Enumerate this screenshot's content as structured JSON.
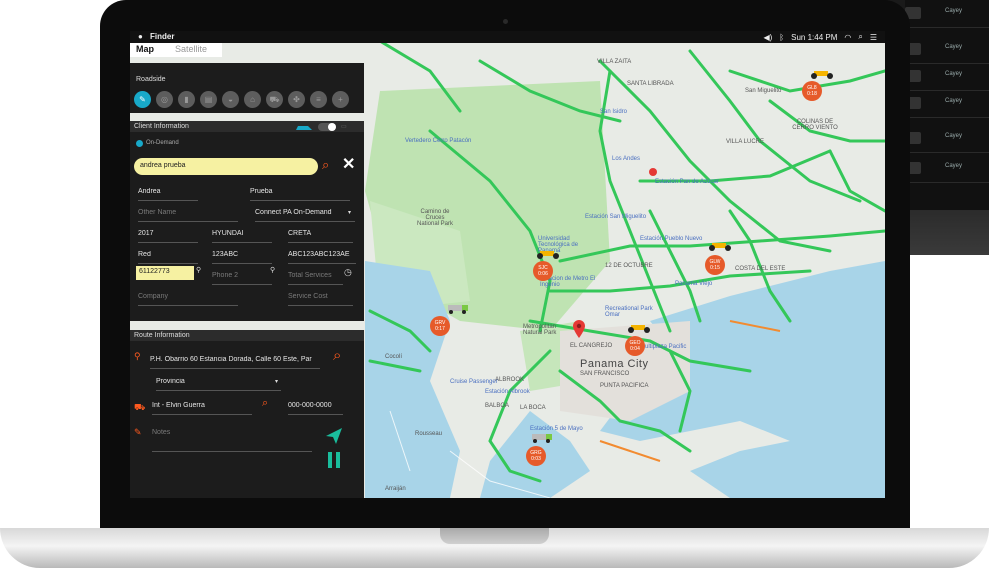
{
  "menubar": {
    "app": "Finder",
    "status": "Sun 1:44 PM"
  },
  "map_tabs": {
    "map": "Map",
    "satellite": "Satellite"
  },
  "back_table": {
    "rows": [
      "Cayey",
      "Cayey",
      "Cayey",
      "Cayey",
      "Cayey",
      "Cayey",
      "Cayey"
    ]
  },
  "roadside": {
    "title": "Roadside",
    "icon_count": 10
  },
  "client": {
    "title": "Client Information",
    "mode": "On-Demand",
    "search_value": "andrea prueba",
    "first_name": "Andrea",
    "last_name": "Prueba",
    "other_name_ph": "Other Name",
    "plan": "Connect PA On-Demand",
    "year": "2017",
    "make": "HYUNDAI",
    "model": "CRETA",
    "color": "Red",
    "plate": "123ABC",
    "vin": "ABC123ABC123AE",
    "phone": "61122773",
    "phone2_ph": "Phone 2",
    "total_services_ph": "Total Services",
    "company_ph": "Company",
    "service_cost_ph": "Service Cost"
  },
  "route": {
    "title": "Route Information",
    "address": "P.H. Obarrio 60 Estancia Dorada, Calle 60 Este, Par",
    "province": "Provincia",
    "provider": "Int - Elvin Guerra",
    "provider_phone": "000-000-0000",
    "notes_ph": "Notes"
  },
  "map_labels": {
    "villa_zaita": "VILLA ZAITA",
    "santa_librada": "SANTA LIBRADA",
    "san_miguelito": "San Miguelito",
    "san_isidro": "San Isidro",
    "villa_lucre": "VILLA LUCRE",
    "colinas": "COLINAS DE CERRO VIENTO",
    "los_andes": "Los Andes",
    "estacion_pan": "Estación Pan de Azúcar",
    "cerro_patacon": "Vertedero Cerro Patacón",
    "camino": "Camino de Cruces National Park",
    "pueblo": "PUEBLO NUEVO",
    "costa": "COSTA DEL ESTE",
    "panama_viejo": "Panama Viejo",
    "panama_city": "Panama City",
    "metropolitan": "Metropolitan Natural Park",
    "recreational": "Recreational Park Omar",
    "multiplaza": "Multiplaza Pacific",
    "albrook": "ALBROOK",
    "balboa": "BALBOA",
    "cocoli": "Cocolí",
    "rousseau": "Rousseau",
    "arraijan": "Arraiján",
    "la_boca": "LA BOCA",
    "cangrejo": "EL CANGREJO",
    "punta_pacifica": "PUNTA PACIFICA",
    "san_francisco": "SAN FRANCISCO",
    "estacion_5m": "Estación 5 de Mayo",
    "tecnologica": "Universidad Tecnológica de Panamá",
    "estacion_sm": "Estación San Miguelito",
    "estacion_pn": "Estación Pueblo Nuevo",
    "el_ingenio": "Estacion de Metro El Ingenio",
    "doce_oct": "12 DE OCTUBRE",
    "albrook_mall": "Estación Albrook",
    "cruise": "Cruise Passenger"
  },
  "markers": [
    {
      "id": "m1",
      "line1": "GL8",
      "line2": "0:18"
    },
    {
      "id": "m2",
      "line1": "SJC",
      "line2": "0:06"
    },
    {
      "id": "m3",
      "line1": "GLW",
      "line2": "0:15"
    },
    {
      "id": "m4",
      "line1": "GRV",
      "line2": "0:17"
    },
    {
      "id": "m5",
      "line1": "GEO",
      "line2": "0:04"
    },
    {
      "id": "m6",
      "line1": "GRG",
      "line2": "0:03"
    }
  ],
  "colors": {
    "accent": "#18a9c9",
    "orange": "#ff5a1f",
    "marker": "#e65a2a",
    "highlight": "#f6f1a2",
    "road": "#34c759",
    "water": "#a8d4e8"
  }
}
